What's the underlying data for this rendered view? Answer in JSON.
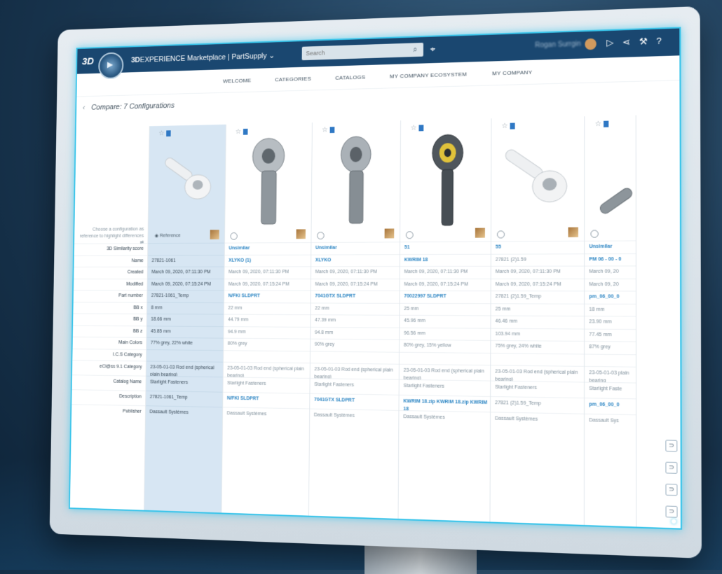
{
  "topbar": {
    "brand": "3D",
    "app_title_bold": "3D",
    "app_title_rest": "EXPERIENCE Marketplace | PartSupply ⌄",
    "search_placeholder": "Search",
    "user_name": "Rogan Surrgin",
    "icons": [
      "tag-icon",
      "user-avatar",
      "play-icon",
      "share-icon",
      "tools-icon",
      "help-icon"
    ]
  },
  "nav": {
    "tabs": [
      "Welcome",
      "Categories",
      "Catalogs",
      "My Company Ecosystem",
      "My Company"
    ]
  },
  "page": {
    "back": "‹",
    "title": "Compare: 7 Configurations"
  },
  "grid": {
    "hint": "Choose a configuration as reference to highlight differences ⇄",
    "reference_label": "Reference",
    "labels": [
      "3D Similarity score",
      "Name",
      "Created",
      "Modified",
      "Part number",
      "BB x",
      "BB y",
      "BB z",
      "Main Colors",
      "I.C.S Category",
      "eCl@ss 9.1 Category",
      "Catalog Name",
      "Description",
      "Publisher"
    ],
    "reference": {
      "values": [
        "",
        "27821-1061",
        "March 09, 2020, 07:11:30 PM",
        "March 09, 2020, 07:15:24 PM",
        "27821-1061_Temp",
        "8 mm",
        "18.66 mm",
        "45.85 mm",
        "77% grey, 22% white",
        "",
        "23-05-01-03 Rod end (spherical plain bearing)",
        "Starlight Fasteners",
        "27821-1061_Temp",
        "Dassault Systèmes"
      ]
    },
    "columns": [
      {
        "score": "Unsimilar",
        "name": "XLYKO (1)",
        "created": "March 09, 2020, 07:11:30 PM",
        "modified": "March 09, 2020, 07:15:24 PM",
        "part": "N/FKI SLDPRT",
        "bbx": "22 mm",
        "bby": "44.79 mm",
        "bbz": "94.9 mm",
        "color": "80% grey",
        "ecl": "23-05-01-03 Rod end (spherical plain bearing)",
        "catalog": "Starlight Fasteners",
        "desc": "N/FKI SLDPRT",
        "pub": "Dassault Systèmes"
      },
      {
        "score": "Unsimilar",
        "name": "XLYKO",
        "created": "March 09, 2020, 07:11:30 PM",
        "modified": "March 09, 2020, 07:15:24 PM",
        "part": "7041GTX SLDPRT",
        "bbx": "22 mm",
        "bby": "47.39 mm",
        "bbz": "94.8 mm",
        "color": "90% grey",
        "ecl": "23-05-01-03 Rod end (spherical plain bearing)",
        "catalog": "Starlight Fasteners",
        "desc": "7041GTX SLDPRT",
        "pub": "Dassault Systèmes"
      },
      {
        "score": "51",
        "name": "KWRIM 18",
        "created": "March 09, 2020, 07:11:30 PM",
        "modified": "March 09, 2020, 07:15:24 PM",
        "part": "70022997 SLDPRT",
        "bbx": "25 mm",
        "bby": "45.96 mm",
        "bbz": "96.56 mm",
        "color": "80% grey, 15% yellow",
        "ecl": "23-05-01-03 Rod end (spherical plain bearing)",
        "catalog": "Starlight Fasteners",
        "desc": "KWRIM 18.zip KWRIM 18.zip KWRIM 18",
        "pub": "Dassault Systèmes"
      },
      {
        "score": "55",
        "name": "27821 (2)1.59",
        "created": "March 09, 2020, 07:11:30 PM",
        "modified": "March 09, 2020, 07:15:24 PM",
        "part": "27821 (2)1.59_Temp",
        "bbx": "25 mm",
        "bby": "46.46 mm",
        "bbz": "103.94 mm",
        "color": "75% grey, 24% white",
        "ecl": "23-05-01-03 Rod end (spherical plain bearing)",
        "catalog": "Starlight Fasteners",
        "desc": "27821 (2)1.59_Temp",
        "pub": "Dassault Systèmes"
      },
      {
        "score": "Unsimilar",
        "name": "PM 06 - 00 - 0",
        "created": "March 09, 20",
        "modified": "March 09, 20",
        "part": "pm_06_00_0",
        "bbx": "18 mm",
        "bby": "23.90 mm",
        "bbz": "77.45 mm",
        "color": "87% grey",
        "ecl": "23-05-01-03 plain bearing",
        "catalog": "Starlight Faste",
        "desc": "pm_06_00_0",
        "pub": "Dassault Sys"
      }
    ]
  }
}
